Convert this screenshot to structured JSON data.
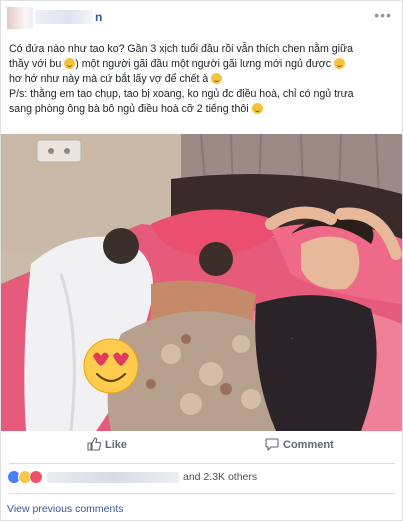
{
  "post": {
    "menu_glyph": "•••",
    "author_tail": "n",
    "lines": [
      "Có đứa nào như tao ko? Gần 3 xịch tuổi đầu rồi vẫn thích chen nằm giữa",
      "thầy với bu",
      ") một người gãi đầu một người gãi lưng mới ngủ được",
      "hơ hớ như này mà cứ bắt lấy vợ để chết à",
      "P/s: thằng em tao chụp, tao bị xoang, ko ngủ đc điều hoà, chỉ có ngủ trưa",
      "sang phòng ông bà bô ngủ điều hoà cỡ 2 tiếng thôi"
    ]
  },
  "actions": {
    "like_label": "Like",
    "comment_label": "Comment"
  },
  "reactions": {
    "icons": [
      "like-reaction-icon",
      "haha-reaction-icon",
      "love-reaction-icon"
    ],
    "count_text": "and 2.3K others"
  },
  "comments": {
    "view_previous": "View previous comments"
  },
  "colors": {
    "link": "#385898",
    "like_blue": "#4a7ef6",
    "love_red": "#f25268",
    "haha_yellow": "#f7c844"
  }
}
